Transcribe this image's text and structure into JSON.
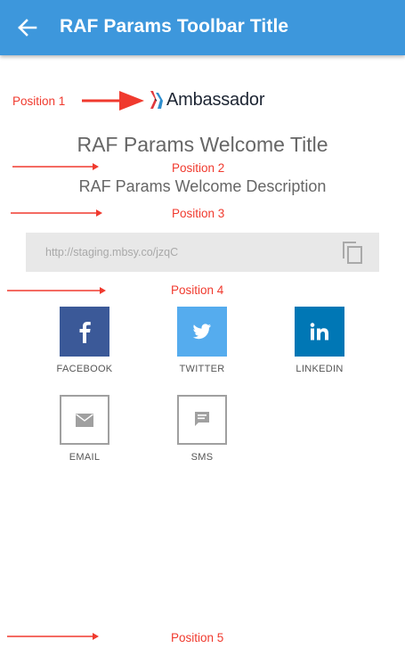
{
  "toolbar": {
    "title": "RAF Params Toolbar Title",
    "background_color": "#3d97dc",
    "back_icon": "arrow-left-icon"
  },
  "annotations": {
    "color": "#f03a2e",
    "labels": [
      "Position 1",
      "Position 2",
      "Position 3",
      "Position 4",
      "Position 5"
    ]
  },
  "logo": {
    "text": "Ambassador",
    "icon": "ambassador-logo-icon"
  },
  "welcome": {
    "title": "RAF Params Welcome Title",
    "description": "RAF Params Welcome Description"
  },
  "share_link": {
    "url": "http://staging.mbsy.co/jzqC",
    "copy_icon": "copy-icon"
  },
  "share_options": [
    {
      "label": "FACEBOOK",
      "icon": "facebook-icon",
      "color": "#3b5998"
    },
    {
      "label": "TWITTER",
      "icon": "twitter-icon",
      "color": "#55acee"
    },
    {
      "label": "LINKEDIN",
      "icon": "linkedin-icon",
      "color": "#0077b5"
    },
    {
      "label": "EMAIL",
      "icon": "email-icon",
      "color": "#a0a0a0"
    },
    {
      "label": "SMS",
      "icon": "sms-icon",
      "color": "#a0a0a0"
    }
  ]
}
